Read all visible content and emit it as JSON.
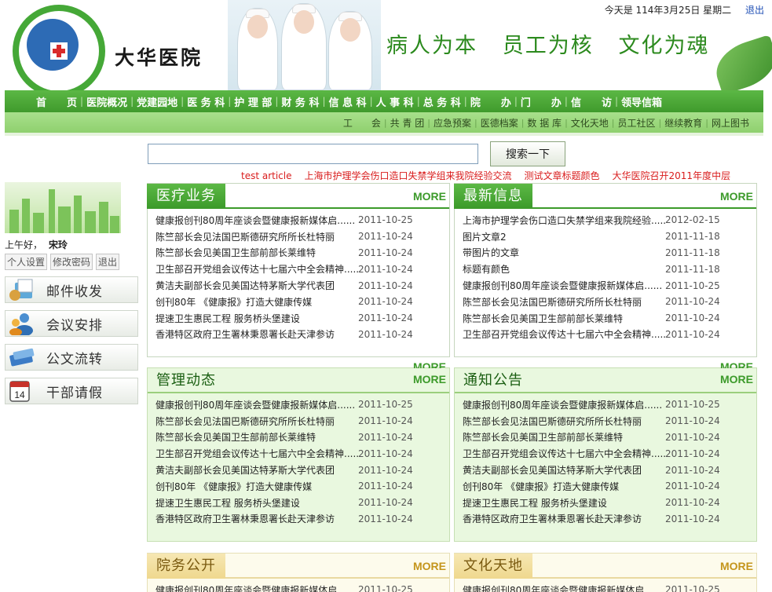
{
  "header": {
    "date_text": "今天是 114年3月25日 星期二",
    "logout": "退出",
    "hospital_name": "大华医院",
    "slogan": "病人为本   员工为核   文化为魂"
  },
  "nav_primary": [
    "首　　页",
    "医院概况",
    "党建园地",
    "医 务 科",
    "护 理 部",
    "财 务 科",
    "信 息 科",
    "人 事 科",
    "总 务 科",
    "院　　办",
    "门　　办",
    "信　　访",
    "领导信箱"
  ],
  "nav_secondary": [
    "工　　会",
    "共 青 团",
    "应急预案",
    "医德档案",
    "数 据 库",
    "文化天地",
    "员工社区",
    "继续教育",
    "网上图书"
  ],
  "search": {
    "placeholder": "",
    "button": "搜索一下"
  },
  "ticker": [
    "test article",
    "上海市护理学会伤口造口失禁学组来我院经验交流",
    "测试文章标题颜色",
    "大华医院召开2011年度中层"
  ],
  "sidebar": {
    "greeting": "上午好，",
    "username": "宋玲",
    "links": [
      "个人设置",
      "修改密码",
      "退出"
    ],
    "buttons": [
      "邮件收发",
      "会议安排",
      "公文流转",
      "干部请假"
    ]
  },
  "panels": {
    "medical": {
      "title": "医疗业务",
      "more": "MORE",
      "items": [
        {
          "title": "健康报创刊80周年座谈会暨健康报新媒体启......",
          "date": "2011-10-25"
        },
        {
          "title": "陈竺部长会见法国巴斯德研究所所长杜特丽",
          "date": "2011-10-24"
        },
        {
          "title": "陈竺部长会见美国卫生部前部长莱维特",
          "date": "2011-10-24"
        },
        {
          "title": "卫生部召开党组会议传达十七届六中全会精神......",
          "date": "2011-10-24"
        },
        {
          "title": "黄洁夫副部长会见美国达特茅斯大学代表团",
          "date": "2011-10-24"
        },
        {
          "title": "创刊80年 《健康报》打造大健康传媒",
          "date": "2011-10-24"
        },
        {
          "title": "提速卫生惠民工程 服务桥头堡建设",
          "date": "2011-10-24"
        },
        {
          "title": "香港特区政府卫生署林秉恩署长赴天津参访",
          "date": "2011-10-24"
        }
      ]
    },
    "latest": {
      "title": "最新信息",
      "more": "MORE",
      "items": [
        {
          "title": "上海市护理学会伤口造口失禁学组来我院经验......",
          "date": "2012-02-15"
        },
        {
          "title": "图片文章2",
          "date": "2011-11-18"
        },
        {
          "title": "带图片的文章",
          "date": "2011-11-18"
        },
        {
          "title": "标题有颜色",
          "date": "2011-11-18"
        },
        {
          "title": "健康报创刊80周年座谈会暨健康报新媒体启......",
          "date": "2011-10-25"
        },
        {
          "title": "陈竺部长会见法国巴斯德研究所所长杜特丽",
          "date": "2011-10-24"
        },
        {
          "title": "陈竺部长会见美国卫生部前部长莱维特",
          "date": "2011-10-24"
        },
        {
          "title": "卫生部召开党组会议传达十七届六中全会精神......",
          "date": "2011-10-24"
        }
      ]
    },
    "management": {
      "title": "管理动态",
      "more": "MORE",
      "ghost_more": "MORE",
      "items": [
        {
          "title": "健康报创刊80周年座谈会暨健康报新媒体启......",
          "date": "2011-10-25"
        },
        {
          "title": "陈竺部长会见法国巴斯德研究所所长杜特丽",
          "date": "2011-10-24"
        },
        {
          "title": "陈竺部长会见美国卫生部前部长莱维特",
          "date": "2011-10-24"
        },
        {
          "title": "卫生部召开党组会议传达十七届六中全会精神......",
          "date": "2011-10-24"
        },
        {
          "title": "黄洁夫副部长会见美国达特茅斯大学代表团",
          "date": "2011-10-24"
        },
        {
          "title": "创刊80年 《健康报》打造大健康传媒",
          "date": "2011-10-24"
        },
        {
          "title": "提速卫生惠民工程 服务桥头堡建设",
          "date": "2011-10-24"
        },
        {
          "title": "香港特区政府卫生署林秉恩署长赴天津参访",
          "date": "2011-10-24"
        }
      ]
    },
    "notice": {
      "title": "通知公告",
      "more": "MORE",
      "ghost_more": "MORE",
      "items": [
        {
          "title": "健康报创刊80周年座谈会暨健康报新媒体启......",
          "date": "2011-10-25"
        },
        {
          "title": "陈竺部长会见法国巴斯德研究所所长杜特丽",
          "date": "2011-10-24"
        },
        {
          "title": "陈竺部长会见美国卫生部前部长莱维特",
          "date": "2011-10-24"
        },
        {
          "title": "卫生部召开党组会议传达十七届六中全会精神......",
          "date": "2011-10-24"
        },
        {
          "title": "黄洁夫副部长会见美国达特茅斯大学代表团",
          "date": "2011-10-24"
        },
        {
          "title": "创刊80年 《健康报》打造大健康传媒",
          "date": "2011-10-24"
        },
        {
          "title": "提速卫生惠民工程 服务桥头堡建设",
          "date": "2011-10-24"
        },
        {
          "title": "香港特区政府卫生署林秉恩署长赴天津参访",
          "date": "2011-10-24"
        }
      ]
    },
    "affairs": {
      "title": "院务公开",
      "more": "MORE",
      "items": [
        {
          "title": "健康报创刊80周年座谈会暨健康报新媒体启......",
          "date": "2011-10-25"
        }
      ]
    },
    "culture": {
      "title": "文化天地",
      "more": "MORE",
      "items": [
        {
          "title": "健康报创刊80周年座谈会暨健康报新媒体启......",
          "date": "2011-10-25"
        }
      ]
    }
  },
  "colors": {
    "brand_green": "#3c9a2a",
    "light_green": "#9fdb80",
    "ticker_red": "#d91d1d",
    "link_blue": "#1f4fb5"
  }
}
